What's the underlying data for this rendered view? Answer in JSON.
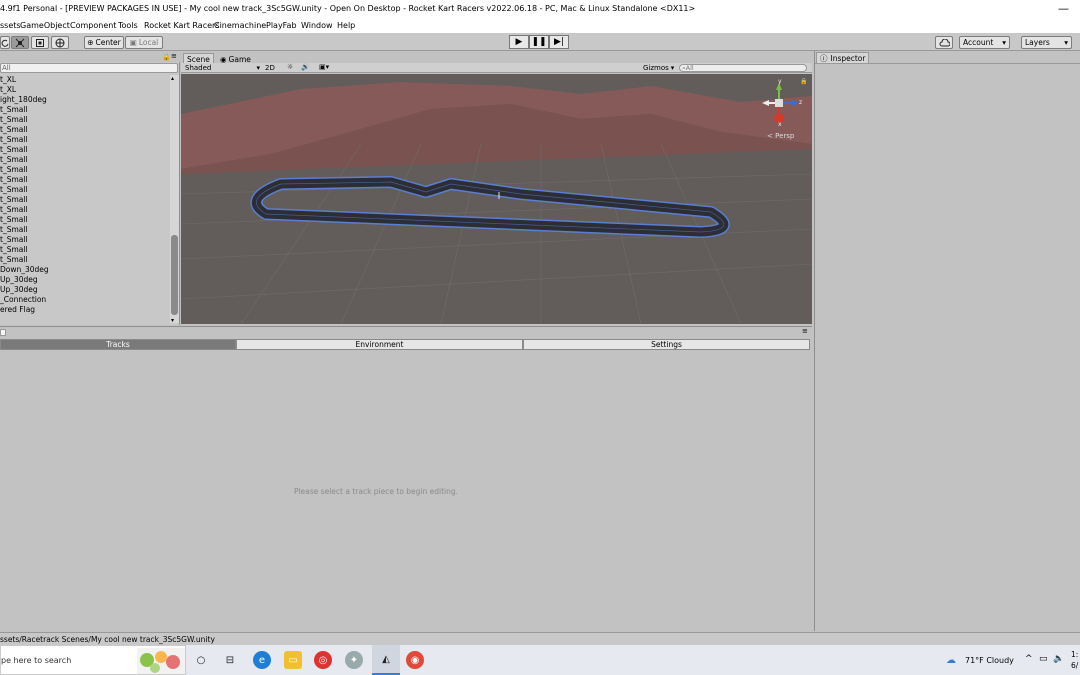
{
  "window": {
    "title": "4.9f1 Personal - [PREVIEW PACKAGES IN USE] - My cool new track_3Sc5GW.unity - Open On Desktop - Rocket Kart Racers v2022.06.18 - PC, Mac & Linux Standalone <DX11>",
    "minimize": "—"
  },
  "menu": [
    "ssets",
    "GameObject",
    "Component",
    "Tools",
    "Rocket Kart Racers",
    "Cinemachine",
    "PlayFab",
    "Window",
    "Help"
  ],
  "toolbar": {
    "pivot": "Center",
    "space": "Local",
    "account": "Account",
    "layers": "Layers"
  },
  "hierarchy": {
    "search_placeholder": "All",
    "items": [
      "t_XL",
      "t_XL",
      "ight_180deg",
      "t_Small",
      "t_Small",
      "t_Small",
      "t_Small",
      "t_Small",
      "t_Small",
      "t_Small",
      "t_Small",
      "t_Small",
      "t_Small",
      "t_Small",
      "t_Small",
      "t_Small",
      "t_Small",
      "t_Small",
      "t_Small",
      "Down_30deg",
      "Up_30deg",
      "Up_30deg",
      "_Connection",
      "ered Flag"
    ]
  },
  "scene": {
    "tab_scene": "Scene",
    "tab_game": "Game",
    "shading": "Shaded",
    "mode_2d": "2D",
    "gizmos": "Gizmos",
    "search_placeholder": "All",
    "persp": "Persp",
    "axis_x": "x",
    "axis_y": "y",
    "axis_z": "z"
  },
  "inspector": {
    "tab": "Inspector"
  },
  "track_editor": {
    "tabs": [
      "Tracks",
      "Environment",
      "Settings"
    ],
    "message": "Please select a track piece to begin editing."
  },
  "status": {
    "path": "ssets/Racetrack Scenes/My cool new track_3Sc5GW.unity"
  },
  "taskbar": {
    "search": "pe here to search",
    "weather": "71°F  Cloudy",
    "time": "1:",
    "date": "6/"
  }
}
